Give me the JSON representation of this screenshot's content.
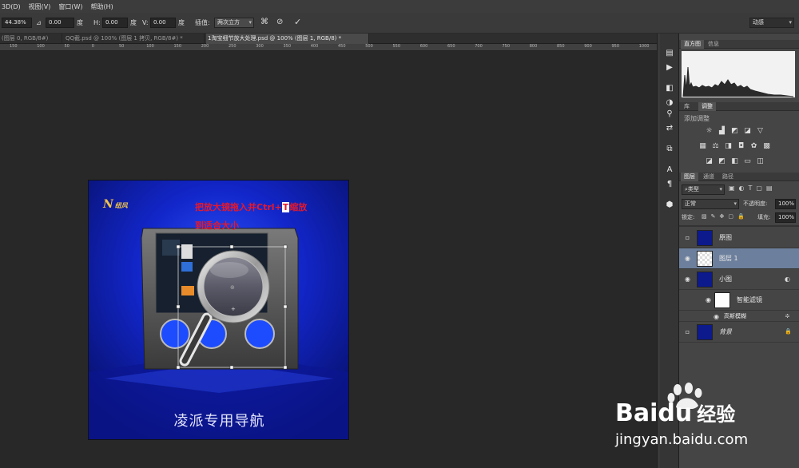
{
  "menu": [
    "3D(D)",
    "视图(V)",
    "窗口(W)",
    "帮助(H)"
  ],
  "options": {
    "zoom": "44.38%",
    "angle": "0.00",
    "angle_unit": "度",
    "h_label": "H:",
    "h_value": "0.00",
    "h_unit": "度",
    "v_label": "V:",
    "v_value": "0.00",
    "v_unit": "度",
    "interp_label": "插值:",
    "interp_value": "两次立方",
    "workspace": "动感"
  },
  "tabs": [
    "(图层 0, RGB/8#)",
    "QQ截.psd @ 100% (图层 1 拷贝, RGB/8#) *",
    "1淘宝细节放大处理.psd @ 100% (图层 1, RGB/8) *"
  ],
  "ruler": [
    "150",
    "100",
    "50",
    "0",
    "50",
    "100",
    "150",
    "200",
    "250",
    "300",
    "350",
    "400",
    "450",
    "500",
    "550",
    "600",
    "650",
    "700",
    "750",
    "800",
    "850",
    "900",
    "950",
    "1000"
  ],
  "document": {
    "brand_logo_text": "N",
    "brand_text": "纽风",
    "instruction_line1_a": "把放大镜拖入并Ctrl+",
    "instruction_key": "T",
    "instruction_line1_b": "缩放",
    "instruction_line2": "到适合大小",
    "caption": "凌派专用导航"
  },
  "histogram_panel": {
    "tabs": [
      "直方图",
      "信息"
    ]
  },
  "adjust_panel": {
    "tabs": [
      "库",
      "调整"
    ],
    "title": "添加调整"
  },
  "layers_panel": {
    "tabs": [
      "图层",
      "通道",
      "路径"
    ],
    "filter": "类型",
    "blend_mode": "正常",
    "opacity_label": "不透明度:",
    "opacity": "100%",
    "lock_label": "锁定:",
    "fill_label": "填充:",
    "fill": "100%",
    "layers": [
      {
        "name": "原图",
        "visible": false,
        "selected": false
      },
      {
        "name": "图层 1",
        "visible": true,
        "selected": true
      },
      {
        "name": "小图",
        "visible": true,
        "selected": false
      },
      {
        "name": "智能滤镜",
        "visible": true,
        "selected": false
      },
      {
        "name": "高斯模糊",
        "visible": true,
        "selected": false
      },
      {
        "name": "背景",
        "visible": false,
        "selected": false
      }
    ]
  },
  "watermark": {
    "brand_a": "Bai",
    "brand_b": "du",
    "brand_cn": "经验",
    "url": "jingyan.baidu.com"
  }
}
